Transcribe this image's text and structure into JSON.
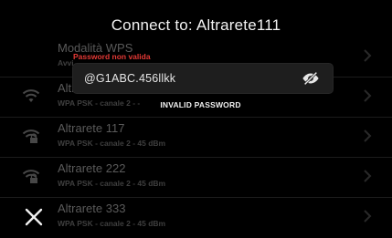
{
  "dialog": {
    "title": "Connect to: Altrarete111"
  },
  "password": {
    "error_label": "Password non valida",
    "value": "@G1ABC.456llkk",
    "status": "INVALID PASSWORD",
    "visibility_icon": "eye-off-icon"
  },
  "networks": [
    {
      "name": "Modalità WPS",
      "detail": "Avvi",
      "icon": "none"
    },
    {
      "name": "Altr",
      "detail": "WPA PSK - canale 2 - -",
      "icon": "wifi-icon"
    },
    {
      "name": "Altrarete 117",
      "detail": "WPA PSK - canale 2 - 45 dBm",
      "icon": "wifi-lock-icon"
    },
    {
      "name": "Altrarete 222",
      "detail": "WPA PSK - canale 2 - 45 dBm",
      "icon": "wifi-lock-icon"
    },
    {
      "name": "Altrarete 333",
      "detail": "WPA PSK - canale 2 - 45 dBm",
      "icon": "wifi-lock-icon"
    }
  ],
  "close_icon": "close-icon",
  "colors": {
    "background": "#000000",
    "error": "#e53935",
    "field": "#1e1e1e"
  }
}
